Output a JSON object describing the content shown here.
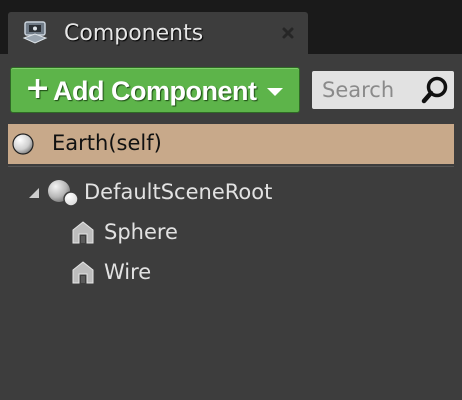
{
  "tab": {
    "title": "Components",
    "icon": "components-icon",
    "close_icon": "close-icon"
  },
  "toolbar": {
    "add_plus": "+",
    "add_label": "Add Component",
    "add_caret_icon": "chevron-down-icon",
    "search_placeholder": "Search",
    "search_value": "",
    "search_icon": "search-icon"
  },
  "tree": {
    "self": {
      "label": "Earth(self)",
      "icon": "sphere-icon"
    },
    "items": [
      {
        "label": "DefaultSceneRoot",
        "icon": "scene-root-icon",
        "expanded": true
      },
      {
        "label": "Sphere",
        "icon": "static-mesh-icon"
      },
      {
        "label": "Wire",
        "icon": "static-mesh-icon"
      }
    ]
  },
  "colors": {
    "background": "#1a1a1a",
    "panel": "#3d3d3d",
    "add_button": "#5db44a",
    "selected_row": "#c8a98a",
    "search_box": "#e2e2e2"
  }
}
